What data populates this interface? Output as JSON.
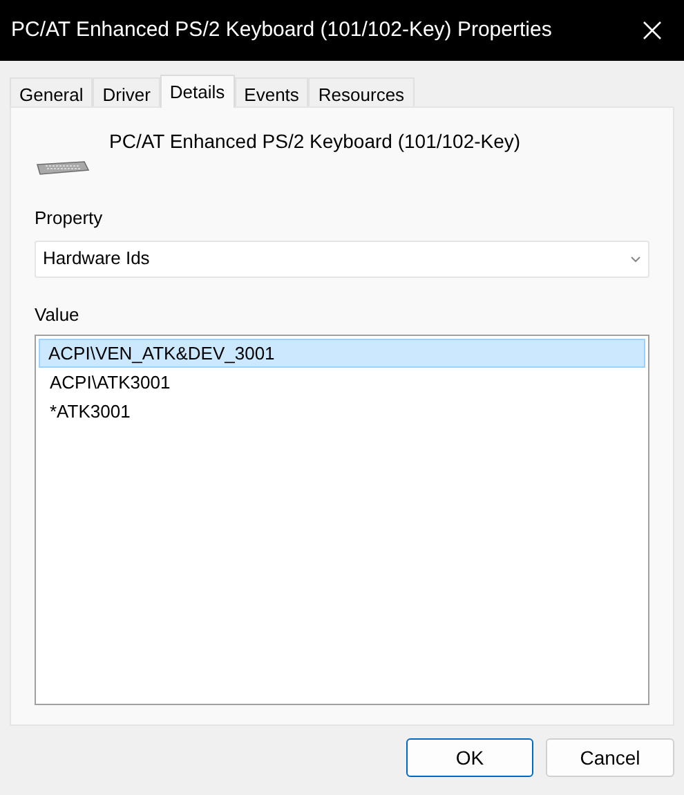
{
  "window": {
    "title": "PC/AT Enhanced PS/2 Keyboard (101/102-Key) Properties"
  },
  "tabs": [
    {
      "label": "General",
      "selected": false
    },
    {
      "label": "Driver",
      "selected": false
    },
    {
      "label": "Details",
      "selected": true
    },
    {
      "label": "Events",
      "selected": false
    },
    {
      "label": "Resources",
      "selected": false
    }
  ],
  "device_name": "PC/AT Enhanced PS/2 Keyboard (101/102-Key)",
  "property": {
    "label": "Property",
    "value": "Hardware Ids"
  },
  "values": {
    "label": "Value",
    "items": [
      {
        "text": "ACPI\\VEN_ATK&DEV_3001",
        "selected": true
      },
      {
        "text": "ACPI\\ATK3001",
        "selected": false
      },
      {
        "text": "*ATK3001",
        "selected": false
      }
    ]
  },
  "buttons": [
    {
      "label": "OK",
      "default": true
    },
    {
      "label": "Cancel",
      "default": false
    }
  ]
}
